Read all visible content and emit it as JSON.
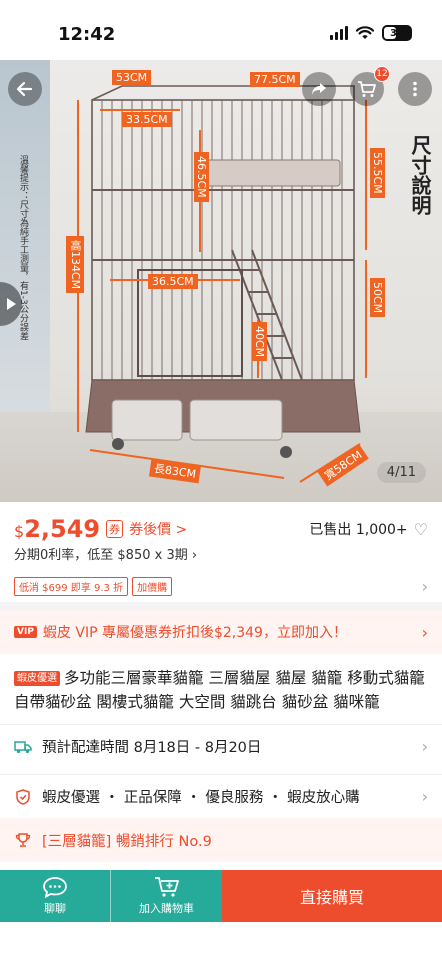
{
  "status_bar": {
    "time": "12:42",
    "battery": "35"
  },
  "image": {
    "counter": "4/11",
    "cart_badge": "12",
    "side_title": "尺寸說明",
    "side_note": "溫馨提示：尺寸為純手工測量，有1-3公分誤差",
    "dimensions": {
      "top_width": "53CM",
      "top_depth": "77.5CM",
      "inner_width": "33.5CM",
      "shelf_height": "46.5CM",
      "mid_width": "36.5CM",
      "ladder_height": "40CM",
      "total_height": "高134CM",
      "upper_height": "55.5CM",
      "lower_height": "50CM",
      "length": "長83CM",
      "width": "寬58CM"
    }
  },
  "price": {
    "symbol": "$",
    "value": "2,549",
    "coupon_icon": "券",
    "coupon_link": "券後價 >",
    "sold": "已售出 1,000+",
    "installment": "分期0利率，低至 $850 x 3期 ›"
  },
  "promos": [
    "低消 $699 即享 9.3 折",
    "加價購"
  ],
  "vip": {
    "icon": "VIP",
    "text": "蝦皮 VIP 專屬優惠券折扣後$2,349，立即加入！"
  },
  "title": {
    "badge": "蝦皮優選",
    "text": "多功能三層豪華貓籠 三層貓屋 貓屋 貓籠 移動式貓籠 自帶貓砂盆 閣樓式貓籠 大空間 貓跳台 貓砂盆 貓咪籠"
  },
  "delivery": {
    "text": "預計配達時間 8月18日 - 8月20日"
  },
  "guarantee": {
    "text": "蝦皮優選 ・ 正品保障 ・ 優良服務 ・ 蝦皮放心購"
  },
  "ranking": {
    "text": "[三層貓籠] 暢銷排行 No.9"
  },
  "bottom_bar": {
    "chat": "聊聊",
    "add_cart": "加入購物車",
    "buy": "直接購買"
  },
  "colors": {
    "accent": "#ee4d2d",
    "teal": "#26aa99"
  }
}
